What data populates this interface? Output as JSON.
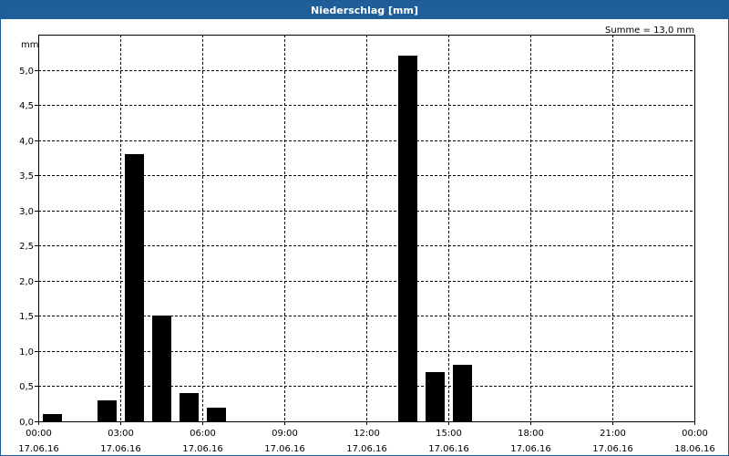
{
  "chart_data": {
    "type": "bar",
    "title": "Niederschlag [mm]",
    "ylabel": "mm",
    "annotation": "Summe = 13,0 mm",
    "ylim": [
      0,
      5.5
    ],
    "yticks": [
      "0,0",
      "0,5",
      "1,0",
      "1,5",
      "2,0",
      "2,5",
      "3,0",
      "3,5",
      "4,0",
      "4,5",
      "5,0"
    ],
    "xlim_hours": [
      0,
      24
    ],
    "xticks": [
      {
        "time": "00:00",
        "date": "17.06.16"
      },
      {
        "time": "03:00",
        "date": "17.06.16"
      },
      {
        "time": "06:00",
        "date": "17.06.16"
      },
      {
        "time": "09:00",
        "date": "17.06.16"
      },
      {
        "time": "12:00",
        "date": "17.06.16"
      },
      {
        "time": "15:00",
        "date": "17.06.16"
      },
      {
        "time": "18:00",
        "date": "17.06.16"
      },
      {
        "time": "21:00",
        "date": "17.06.16"
      },
      {
        "time": "00:00",
        "date": "18.06.16"
      }
    ],
    "x": [
      "01:00",
      "02:00",
      "03:00",
      "04:00",
      "05:00",
      "06:00",
      "07:00",
      "08:00",
      "09:00",
      "10:00",
      "11:00",
      "12:00",
      "13:00",
      "14:00",
      "15:00",
      "16:00"
    ],
    "values": [
      0.1,
      0.0,
      0.3,
      3.8,
      1.5,
      0.4,
      0.2,
      0.0,
      0.0,
      0.0,
      0.0,
      0.0,
      0.0,
      5.2,
      0.7,
      0.8
    ],
    "grid": true,
    "bar_color": "#000000"
  }
}
